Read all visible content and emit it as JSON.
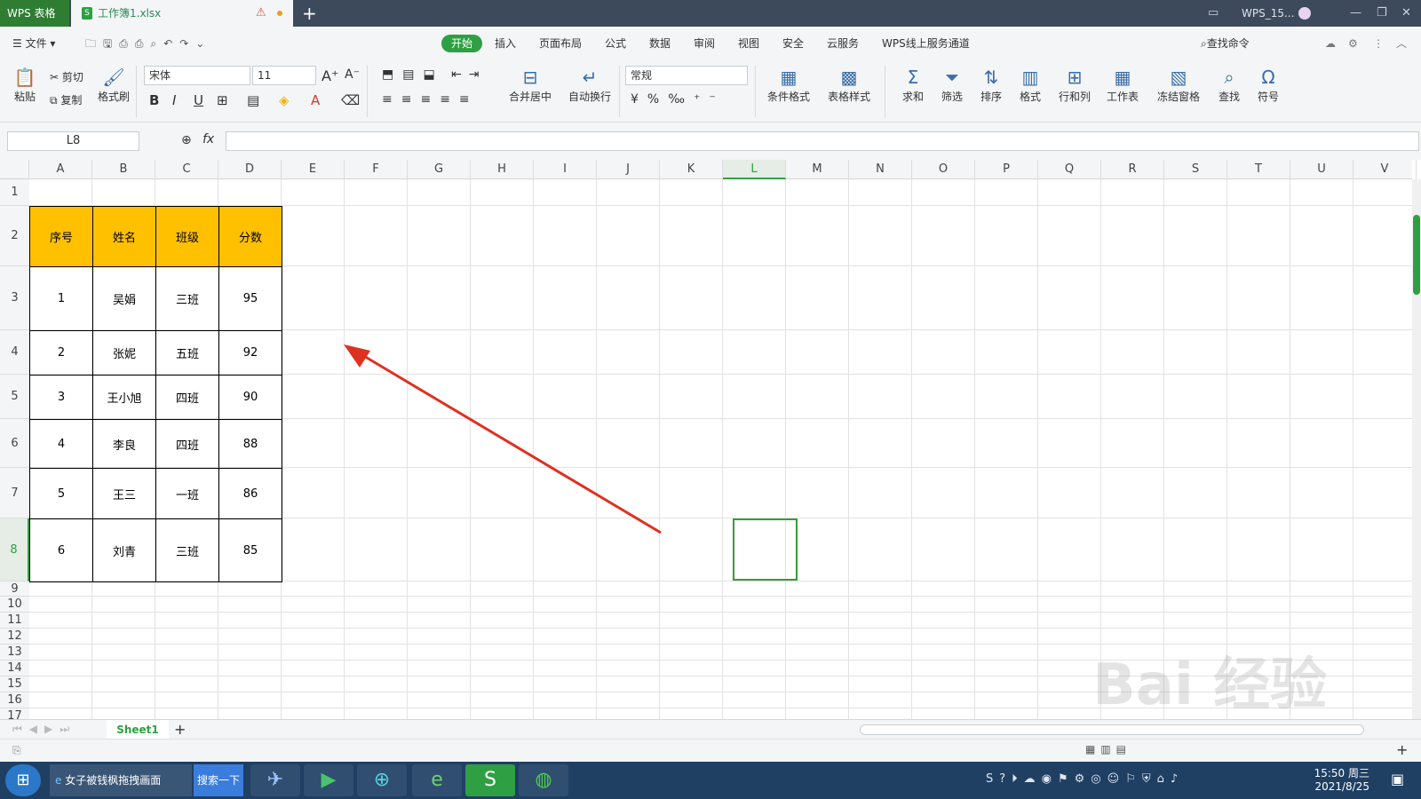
{
  "titlebar": {
    "app_name": "WPS 表格",
    "file_name": "工作簿1.xlsx",
    "new_tab": "+",
    "account": "WPS_15..."
  },
  "menu": {
    "file": "文件",
    "tabs": [
      "开始",
      "插入",
      "页面布局",
      "公式",
      "数据",
      "审阅",
      "视图",
      "安全",
      "云服务",
      "WPS线上服务通道"
    ],
    "search_cmd": "查找命令"
  },
  "ribbon": {
    "paste": "粘贴",
    "cut": "剪切",
    "copy": "复制",
    "format_painter": "格式刷",
    "font_name": "宋体",
    "font_size": "11",
    "merge_center": "合并居中",
    "auto_wrap": "自动换行",
    "number_format": "常规",
    "cond_format": "条件格式",
    "table_style": "表格样式",
    "sum": "求和",
    "filter": "筛选",
    "sort": "排序",
    "format": "格式",
    "row_col": "行和列",
    "worksheet": "工作表",
    "freeze": "冻结窗格",
    "find": "查找",
    "symbol": "符号"
  },
  "formula_bar": {
    "name_box": "L8",
    "fx": "fx",
    "value": ""
  },
  "columns": [
    "A",
    "B",
    "C",
    "D",
    "E",
    "F",
    "G",
    "H",
    "I",
    "J",
    "K",
    "L",
    "M",
    "N",
    "O",
    "P",
    "Q",
    "R",
    "S",
    "T",
    "U",
    "V"
  ],
  "rows": [
    "1",
    "2",
    "3",
    "4",
    "5",
    "6",
    "7",
    "8",
    "9",
    "10",
    "11",
    "12",
    "13",
    "14",
    "15",
    "16",
    "17"
  ],
  "table": {
    "headers": [
      "序号",
      "姓名",
      "班级",
      "分数"
    ],
    "rows": [
      [
        "1",
        "吴娟",
        "三班",
        "95"
      ],
      [
        "2",
        "张妮",
        "五班",
        "92"
      ],
      [
        "3",
        "王小旭",
        "四班",
        "90"
      ],
      [
        "4",
        "李良",
        "四班",
        "88"
      ],
      [
        "5",
        "王三",
        "一班",
        "86"
      ],
      [
        "6",
        "刘青",
        "三班",
        "85"
      ]
    ]
  },
  "sheets": {
    "active": "Sheet1",
    "add": "+"
  },
  "taskbar": {
    "ie_title": "女子被钱枫拖拽画面",
    "search_btn": "搜索一下",
    "time": "15:50 周三",
    "date": "2021/8/25"
  },
  "watermark": "Bai 经验",
  "colors": {
    "header_fill": "#ffc000",
    "accent": "#2ea043",
    "arrow": "#e03020"
  }
}
